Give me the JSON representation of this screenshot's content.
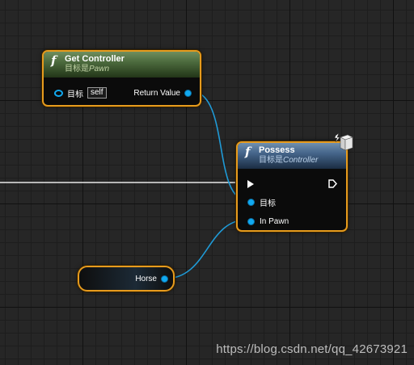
{
  "get_controller": {
    "fn_glyph": "f",
    "title": "Get Controller",
    "subtitle_target": "目标是",
    "subtitle_class": "Pawn",
    "target_label": "目标",
    "self_value": "self",
    "return_label": "Return Value"
  },
  "possess": {
    "fn_glyph": "f",
    "title": "Possess",
    "subtitle_target": "目标是",
    "subtitle_class": "Controller",
    "target_label": "目标",
    "in_pawn_label": "In Pawn"
  },
  "horse_var": {
    "label": "Horse"
  },
  "watermark": "https://blog.csdn.net/qq_42673921",
  "colors": {
    "node_border": "#e69b1e",
    "pin_object": "#11a9f0",
    "wire_object": "#1f9ad6",
    "exec_wire": "#e8e8e8",
    "grid_bg": "#262626"
  },
  "icons": {
    "function": "function-f-icon",
    "network": "network-cube-icon",
    "exec": "exec-arrow-icon"
  }
}
